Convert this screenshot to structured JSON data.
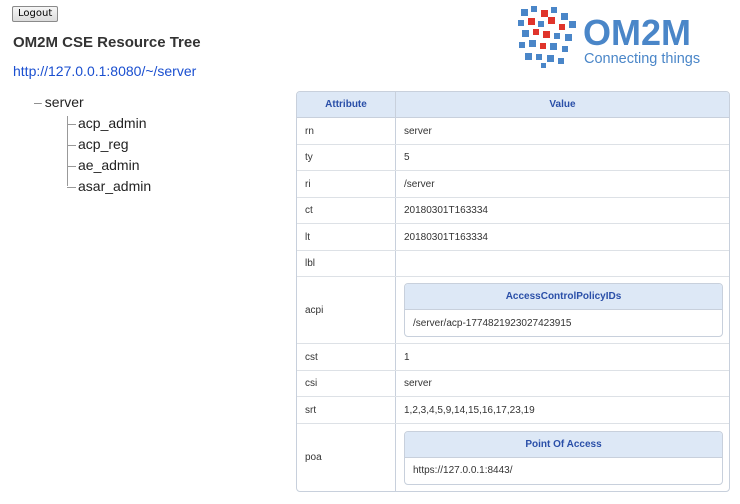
{
  "logout_label": "Logout",
  "page_title": "OM2M CSE Resource Tree",
  "cse_url": "http://127.0.0.1:8080/~/server",
  "logo": {
    "name": "OM2M",
    "tagline": "Connecting things",
    "color": "#4a86c8"
  },
  "tree": {
    "root": "server",
    "children": [
      "acp_admin",
      "acp_reg",
      "ae_admin",
      "asar_admin"
    ]
  },
  "table": {
    "headers": {
      "attribute": "Attribute",
      "value": "Value"
    },
    "rows": [
      {
        "attr": "rn",
        "value": "server"
      },
      {
        "attr": "ty",
        "value": "5"
      },
      {
        "attr": "ri",
        "value": "/server"
      },
      {
        "attr": "ct",
        "value": "20180301T163334"
      },
      {
        "attr": "lt",
        "value": "20180301T163334"
      },
      {
        "attr": "lbl",
        "value": ""
      },
      {
        "attr": "acpi",
        "inner_header": "AccessControlPolicyIDs",
        "inner_value": "/server/acp-1774821923027423915"
      },
      {
        "attr": "cst",
        "value": "1"
      },
      {
        "attr": "csi",
        "value": "server"
      },
      {
        "attr": "srt",
        "value": "1,2,3,4,5,9,14,15,16,17,23,19"
      },
      {
        "attr": "poa",
        "inner_header": "Point Of Access",
        "inner_value": "https://127.0.0.1:8443/"
      }
    ]
  }
}
